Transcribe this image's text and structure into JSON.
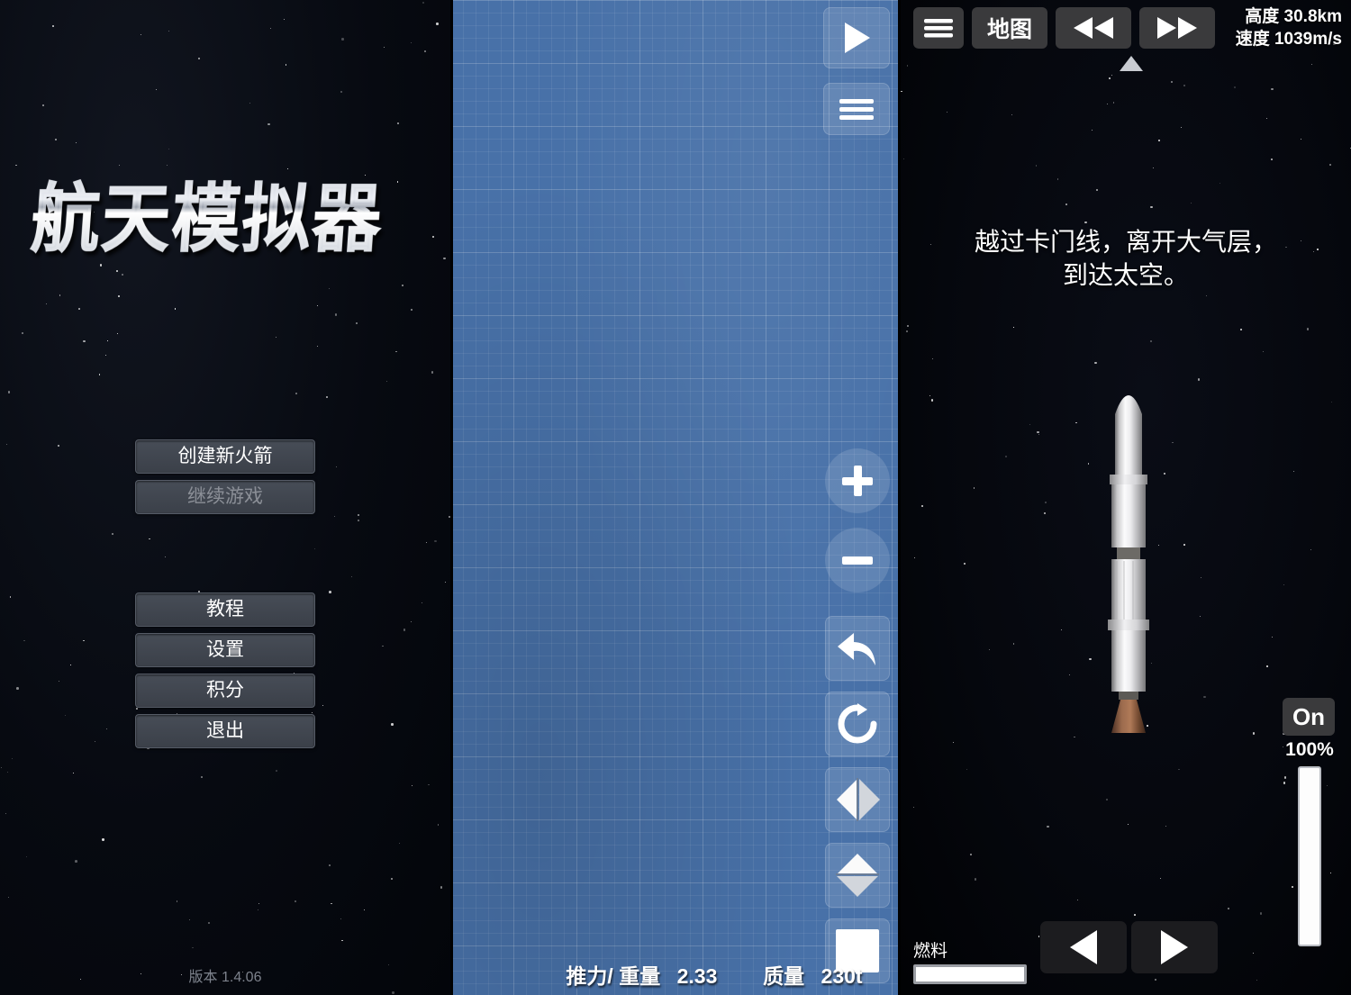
{
  "app": {
    "title": "航天模拟器",
    "version_label": "版本 1.4.06"
  },
  "main_menu": {
    "buttons": [
      {
        "label": "创建新火箭",
        "state": "enabled",
        "name": "create-new-rocket-button"
      },
      {
        "label": "继续游戏",
        "state": "disabled",
        "name": "continue-game-button"
      },
      {
        "label": "教程",
        "state": "enabled",
        "name": "tutorial-button"
      },
      {
        "label": "设置",
        "state": "enabled",
        "name": "settings-button"
      },
      {
        "label": "积分",
        "state": "enabled",
        "name": "credits-button"
      },
      {
        "label": "退出",
        "state": "enabled",
        "name": "quit-button"
      }
    ]
  },
  "build_editor": {
    "menu_icon": "hamburger-menu-icon",
    "launch_icon": "play-icon",
    "staging_icon": "hamburger-menu-icon",
    "tools": [
      {
        "name": "zoom-in-button",
        "icon": "plus-icon"
      },
      {
        "name": "zoom-out-button",
        "icon": "minus-icon"
      },
      {
        "name": "undo-button",
        "icon": "undo-arrow-icon"
      },
      {
        "name": "rotate-button",
        "icon": "rotate-cw-icon"
      },
      {
        "name": "mirror-horizontal-button",
        "icon": "mirror-horizontal-icon"
      },
      {
        "name": "mirror-vertical-button",
        "icon": "mirror-vertical-icon"
      },
      {
        "name": "color-picker-button",
        "icon": "white-square-icon"
      }
    ],
    "palette_parts": [
      "capsule-part",
      "small-cone-part",
      "short-fuel-tank-part",
      "tall-fuel-tank-part",
      "slim-fuel-tank-part",
      "large-engine-part",
      "small-engine-part",
      "separator-part",
      "landing-legs-part",
      "strut-part",
      "nose-cone-part",
      "wheel-part",
      "docking-port-part",
      "rcs-thruster-part"
    ],
    "stats": {
      "thrust_weight_label": "推力/ 重量",
      "thrust_weight_value": "2.33",
      "mass_label": "质量",
      "mass_value": "230t"
    }
  },
  "flight_view": {
    "toolbar": [
      {
        "name": "flight-menu-button",
        "label": "",
        "icon": "hamburger-menu-icon"
      },
      {
        "name": "map-button",
        "label": "地图",
        "icon": ""
      },
      {
        "name": "time-rewind-button",
        "label": "",
        "icon": "rewind-icon"
      },
      {
        "name": "time-warp-button",
        "label": "",
        "icon": "fast-forward-icon"
      }
    ],
    "readout": {
      "altitude_label": "高度",
      "altitude_value": "30.8km",
      "velocity_label": "速度",
      "velocity_value": "1039m/s"
    },
    "navball_marker_icon": "prograde-marker-icon",
    "mission_text_line1": "越过卡门线，离开大气层，",
    "mission_text_line2": "到达太空。",
    "throttle": {
      "toggle_label": "On",
      "percent": "100%",
      "fill_ratio": 1.0
    },
    "fuel": {
      "label": "燃料",
      "fill_ratio": 1.0
    },
    "nav_buttons": [
      {
        "name": "rotate-left-button",
        "icon": "triangle-left-icon"
      },
      {
        "name": "rotate-right-button",
        "icon": "triangle-right-icon"
      }
    ]
  },
  "colors": {
    "blueprint_blue": "#4871a8",
    "palette_blue": "#b0d4ea",
    "menu_button": "#3b4049",
    "hud_button": "#3a3a3c",
    "space_black": "#05070d",
    "accent_white": "#ffffff"
  }
}
